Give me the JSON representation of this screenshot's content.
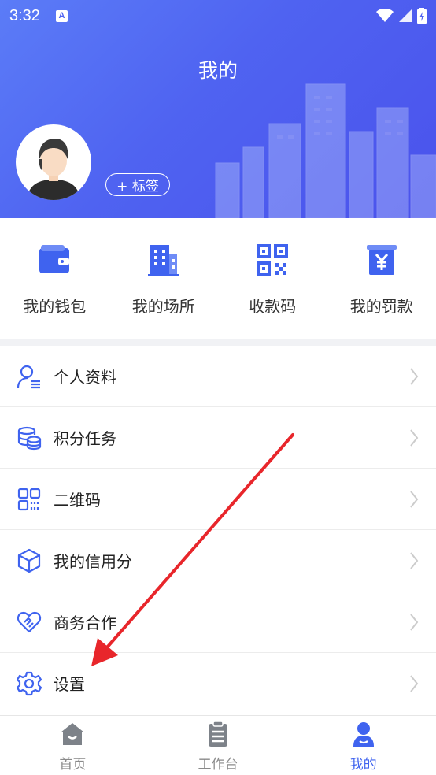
{
  "status_bar": {
    "time": "3:32",
    "badge": "A"
  },
  "header": {
    "title": "我的",
    "tag_button": "+ 标签"
  },
  "quick_actions": [
    {
      "label": "我的钱包",
      "icon": "wallet-icon"
    },
    {
      "label": "我的场所",
      "icon": "building-icon"
    },
    {
      "label": "收款码",
      "icon": "qr-code-icon"
    },
    {
      "label": "我的罚款",
      "icon": "fine-yen-icon"
    }
  ],
  "menu": [
    {
      "label": "个人资料",
      "icon": "person-profile-icon"
    },
    {
      "label": "积分任务",
      "icon": "coins-stack-icon"
    },
    {
      "label": "二维码",
      "icon": "qr-grid-icon"
    },
    {
      "label": "我的信用分",
      "icon": "cube-icon"
    },
    {
      "label": "商务合作",
      "icon": "heart-handshake-icon"
    },
    {
      "label": "设置",
      "icon": "gear-icon"
    }
  ],
  "bottom_nav": [
    {
      "label": "首页",
      "icon": "home-icon"
    },
    {
      "label": "工作台",
      "icon": "clipboard-icon"
    },
    {
      "label": "我的",
      "icon": "user-icon",
      "active": true
    }
  ],
  "colors": {
    "accent": "#3f63ef",
    "header_start": "#5b7cf7",
    "header_end": "#4a52ec",
    "arrow": "#e8262b"
  }
}
